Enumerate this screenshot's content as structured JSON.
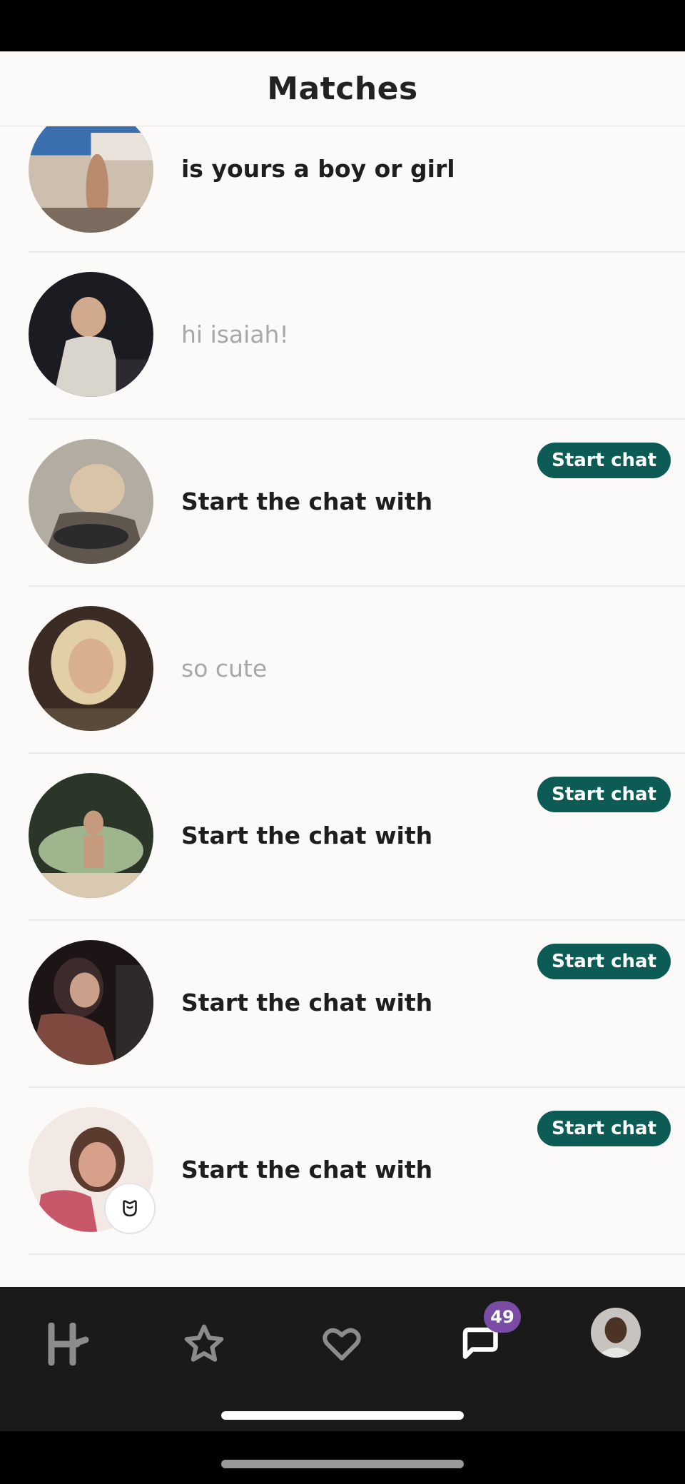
{
  "header": {
    "title": "Matches"
  },
  "matches": [
    {
      "message": "is yours a boy or girl",
      "style": "bold",
      "start_chat": null,
      "colors": [
        "#3b6fb0",
        "#cdbfae",
        "#7a6b5e"
      ]
    },
    {
      "message": "hi isaiah!",
      "style": "light",
      "start_chat": null,
      "colors": [
        "#1b1b22",
        "#d9d4cc",
        "#2c2a30"
      ]
    },
    {
      "message": "Start the chat with",
      "style": "bold",
      "start_chat": "Start chat",
      "colors": [
        "#b3aca0",
        "#5f574d",
        "#d9c4a8"
      ]
    },
    {
      "message": "so cute",
      "style": "light",
      "start_chat": null,
      "colors": [
        "#3a2c24",
        "#e3cfa6",
        "#5a4a3a"
      ]
    },
    {
      "message": "Start the chat with",
      "style": "bold",
      "start_chat": "Start chat",
      "colors": [
        "#2b3528",
        "#9fb58e",
        "#6e7c5e"
      ]
    },
    {
      "message": "Start the chat with",
      "style": "bold",
      "start_chat": "Start chat",
      "colors": [
        "#1d1515",
        "#7e4a40",
        "#3d2a2a"
      ]
    },
    {
      "message": "Start the chat with",
      "style": "bold",
      "start_chat": "Start chat",
      "colors": [
        "#f2e9e4",
        "#d6a08a",
        "#c8576a"
      ],
      "rose_icon": "rose-icon"
    }
  ],
  "nav": {
    "items": [
      "home-icon",
      "star-icon",
      "heart-icon",
      "chat-icon",
      "profile-avatar"
    ],
    "chat_badge": "49",
    "inactive_color": "#8c8c8c",
    "active_color": "#ffffff",
    "badge_color": "#7a4ca6"
  },
  "accent": "#0c5c55"
}
